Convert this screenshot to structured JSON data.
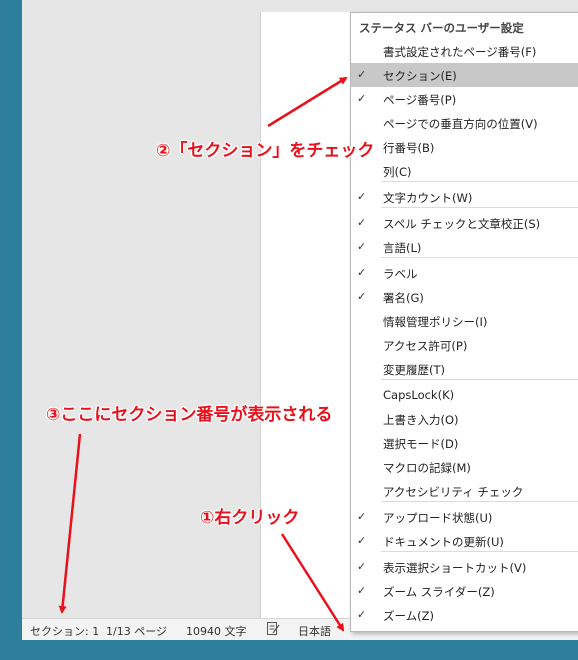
{
  "status_bar": {
    "section": "セクション: 1",
    "page": "1/13 ページ",
    "words": "10940 文字",
    "language": "日本語"
  },
  "menu": {
    "title": "ステータス バーのユーザー設定",
    "items": [
      {
        "label": "書式設定されたページ番号(F)",
        "checked": false
      },
      {
        "label": "セクション(E)",
        "checked": true
      },
      {
        "label": "ページ番号(P)",
        "checked": true
      },
      {
        "label": "ページでの垂直方向の位置(V)",
        "checked": false
      },
      {
        "label": "行番号(B)",
        "checked": false
      },
      {
        "label": "列(C)",
        "checked": false
      },
      {
        "label": "文字カウント(W)",
        "checked": true
      },
      {
        "label": "スペル チェックと文章校正(S)",
        "checked": true
      },
      {
        "label": "言語(L)",
        "checked": true
      },
      {
        "label": "ラベル",
        "checked": true
      },
      {
        "label": "署名(G)",
        "checked": true
      },
      {
        "label": "情報管理ポリシー(I)",
        "checked": false
      },
      {
        "label": "アクセス許可(P)",
        "checked": false
      },
      {
        "label": "変更履歴(T)",
        "checked": false
      },
      {
        "label": "CapsLock(K)",
        "checked": false
      },
      {
        "label": "上書き入力(O)",
        "checked": false
      },
      {
        "label": "選択モード(D)",
        "checked": false
      },
      {
        "label": "マクロの記録(M)",
        "checked": false
      },
      {
        "label": "アクセシビリティ チェック",
        "checked": false
      },
      {
        "label": "アップロード状態(U)",
        "checked": true
      },
      {
        "label": "ドキュメントの更新(U)",
        "checked": true
      },
      {
        "label": "表示選択ショートカット(V)",
        "checked": true
      },
      {
        "label": "ズーム スライダー(Z)",
        "checked": true
      },
      {
        "label": "ズーム(Z)",
        "checked": true
      }
    ]
  },
  "annotations": {
    "step1": "①右クリック",
    "step2": "②「セクション」をチェック",
    "step3": "③ここにセクション番号が表示される"
  },
  "colors": {
    "annotation": "#e8111b",
    "highlight": "#c8c8c8",
    "desktop": "#2d7f9d"
  }
}
